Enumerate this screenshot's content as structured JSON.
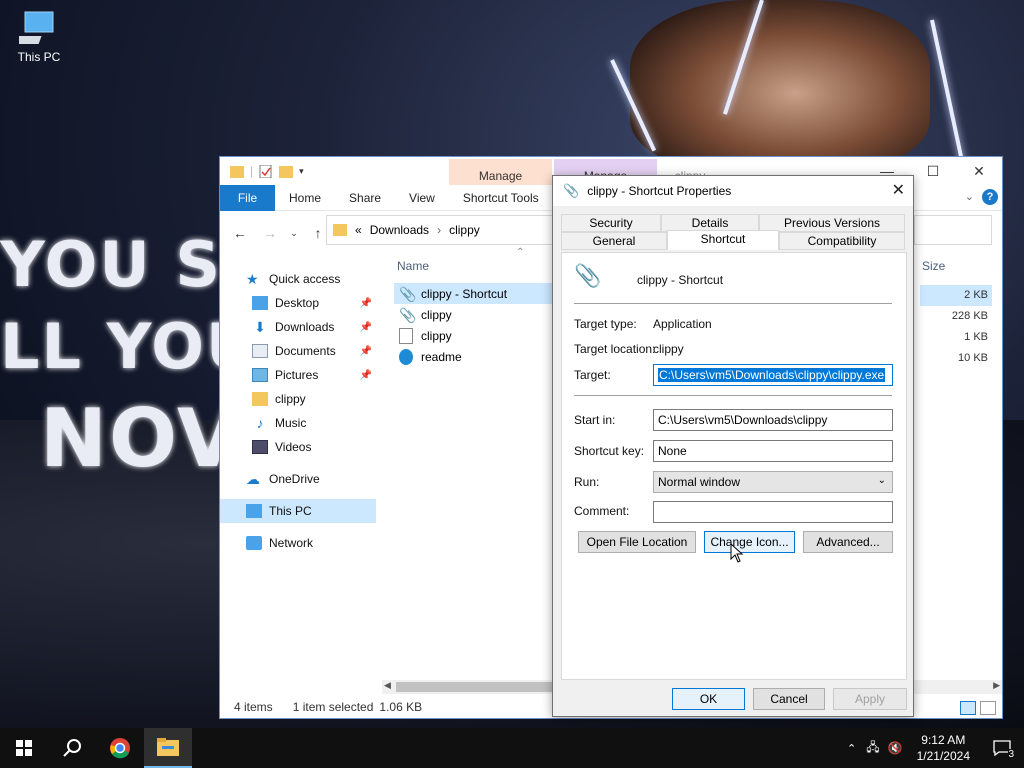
{
  "desktop": {
    "icons": [
      {
        "label": "This PC",
        "icon": "this-pc-icon"
      }
    ],
    "wallpaper_text": [
      "YOU SH",
      "LL YOU",
      "NOV"
    ]
  },
  "explorer": {
    "context_tabs": [
      "Manage",
      "Manage",
      "clippy"
    ],
    "ribbon_tabs": [
      "File",
      "Home",
      "Share",
      "View",
      "Shortcut Tools"
    ],
    "address": {
      "prefix": "«",
      "parts": [
        "Downloads",
        "clippy"
      ]
    },
    "nav": {
      "quick_access": "Quick access",
      "items": [
        {
          "label": "Desktop",
          "icon": "desktop-icon",
          "pinned": true
        },
        {
          "label": "Downloads",
          "icon": "downloads-icon",
          "pinned": true
        },
        {
          "label": "Documents",
          "icon": "documents-icon",
          "pinned": true
        },
        {
          "label": "Pictures",
          "icon": "pictures-icon",
          "pinned": true
        },
        {
          "label": "clippy",
          "icon": "folder-icon",
          "pinned": false
        },
        {
          "label": "Music",
          "icon": "music-icon",
          "pinned": false
        },
        {
          "label": "Videos",
          "icon": "videos-icon",
          "pinned": false
        }
      ],
      "onedrive": "OneDrive",
      "this_pc": "This PC",
      "network": "Network"
    },
    "columns": {
      "name": "Name",
      "size": "Size"
    },
    "files": [
      {
        "name": "clippy - Shortcut",
        "icon": "shortcut-clippy-icon",
        "size": "2 KB",
        "selected": true
      },
      {
        "name": "clippy",
        "icon": "clippy-exe-icon",
        "size": "228 KB",
        "selected": false
      },
      {
        "name": "clippy",
        "icon": "text-file-icon",
        "size": "1 KB",
        "selected": false
      },
      {
        "name": "readme",
        "icon": "edge-icon",
        "size": "10 KB",
        "selected": false
      }
    ],
    "status": {
      "count": "4 items",
      "selection": "1 item selected",
      "size": "1.06 KB"
    }
  },
  "dialog": {
    "title": "clippy - Shortcut Properties",
    "tabs_row1": [
      "Security",
      "Details",
      "Previous Versions"
    ],
    "tabs_row2": [
      "General",
      "Shortcut",
      "Compatibility"
    ],
    "active_tab": "Shortcut",
    "header_name": "clippy - Shortcut",
    "target_type_label": "Target type:",
    "target_type_value": "Application",
    "target_location_label": "Target location:",
    "target_location_value": "clippy",
    "target_label": "Target:",
    "target_value": "C:\\Users\\vm5\\Downloads\\clippy\\clippy.exe",
    "start_in_label": "Start in:",
    "start_in_value": "C:\\Users\\vm5\\Downloads\\clippy",
    "shortcut_key_label": "Shortcut key:",
    "shortcut_key_value": "None",
    "run_label": "Run:",
    "run_value": "Normal window",
    "comment_label": "Comment:",
    "comment_value": "",
    "buttons": {
      "open_location": "Open File Location",
      "change_icon": "Change Icon...",
      "advanced": "Advanced..."
    },
    "footer": {
      "ok": "OK",
      "cancel": "Cancel",
      "apply": "Apply"
    }
  },
  "taskbar": {
    "time": "9:12 AM",
    "date": "1/21/2024",
    "notification_count": "3"
  }
}
